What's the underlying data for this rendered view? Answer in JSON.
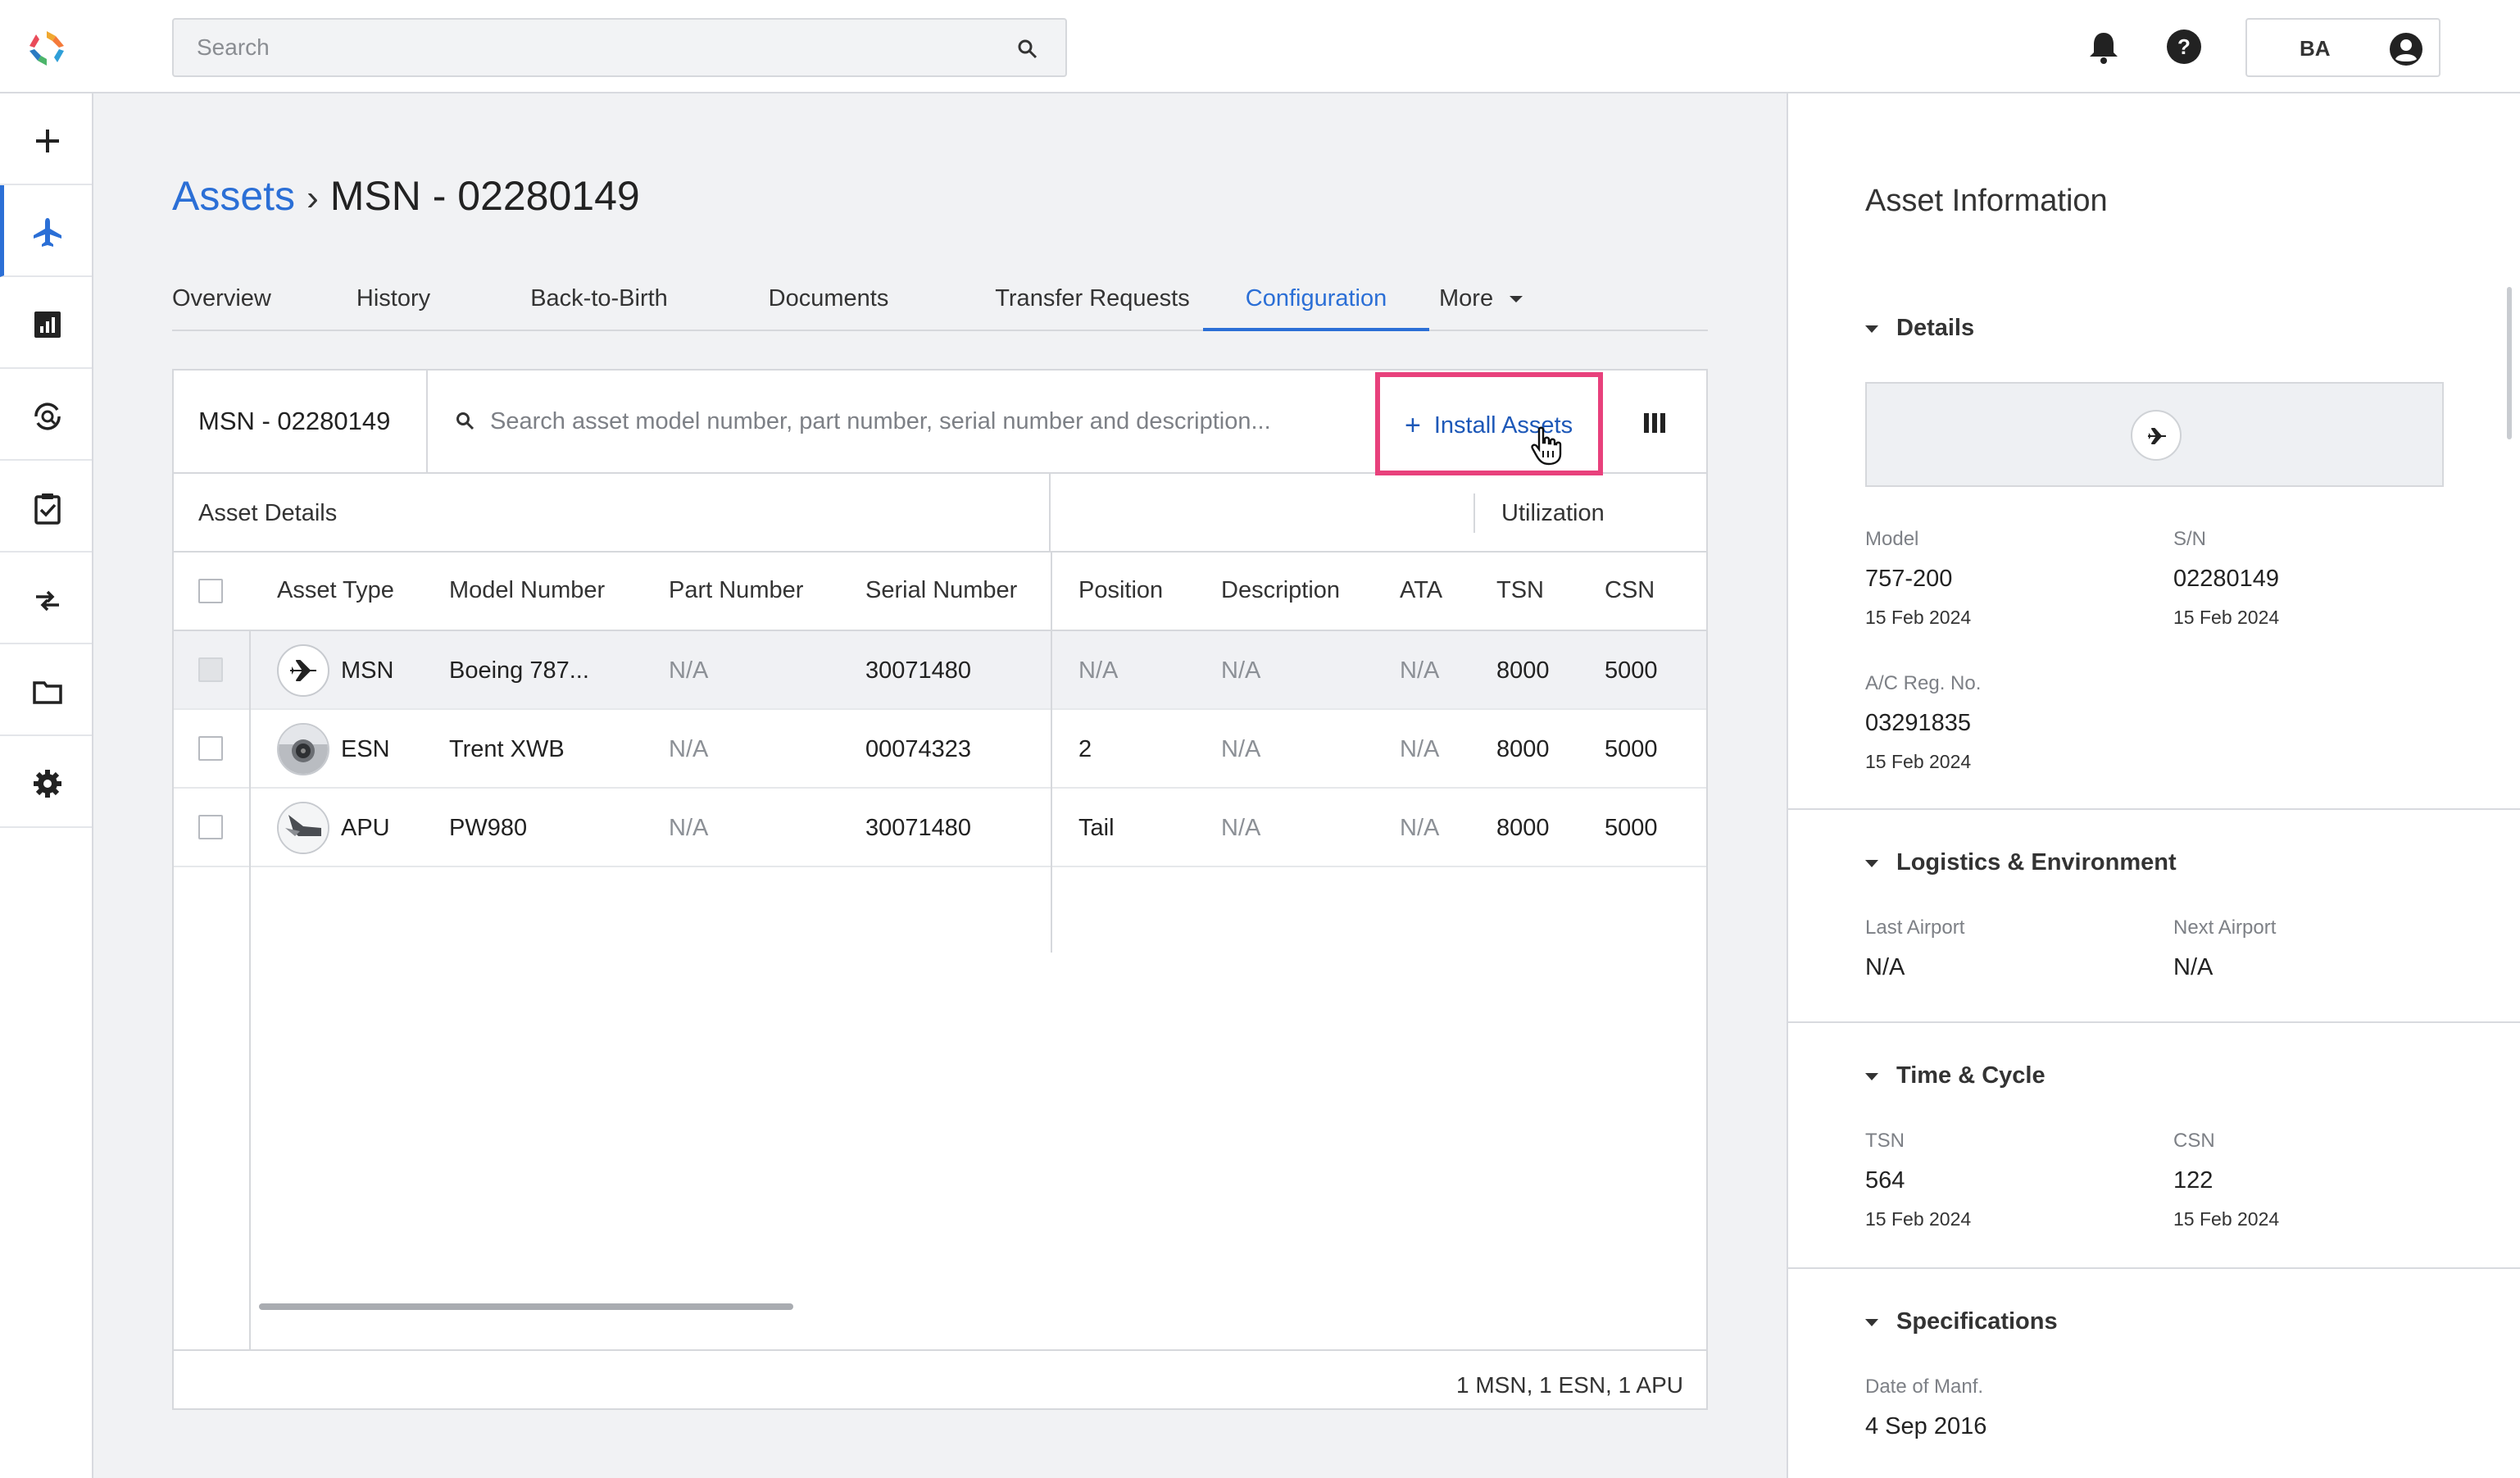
{
  "topbar": {
    "search_placeholder": "Search",
    "user_initials": "BA"
  },
  "breadcrumb": {
    "root": "Assets",
    "separator": "›",
    "current": "MSN - 02280149"
  },
  "tabs": [
    {
      "label": "Overview"
    },
    {
      "label": "History"
    },
    {
      "label": "Back-to-Birth"
    },
    {
      "label": "Documents"
    },
    {
      "label": "Transfer Requests"
    },
    {
      "label": "Configuration",
      "active": true
    },
    {
      "label": "More"
    }
  ],
  "toolbar": {
    "msn_label": "MSN - 02280149",
    "search_placeholder": "Search asset model number, part number, serial number and description...",
    "install_label": "Install Assets"
  },
  "table": {
    "group_left": "Asset Details",
    "group_right": "Utilization",
    "headers": {
      "asset_type": "Asset Type",
      "model_number": "Model Number",
      "part_number": "Part Number",
      "serial_number": "Serial Number",
      "position": "Position",
      "description": "Description",
      "ata": "ATA",
      "tsn": "TSN",
      "csn": "CSN"
    },
    "rows": [
      {
        "type": "MSN",
        "icon": "airplane-icon",
        "model": "Boeing 787...",
        "part": "N/A",
        "serial": "30071480",
        "position": "N/A",
        "description": "N/A",
        "ata": "N/A",
        "tsn": "8000",
        "csn": "5000"
      },
      {
        "type": "ESN",
        "icon": "engine-icon",
        "model": "Trent XWB",
        "part": "N/A",
        "serial": "00074323",
        "position": "2",
        "description": "N/A",
        "ata": "N/A",
        "tsn": "8000",
        "csn": "5000"
      },
      {
        "type": "APU",
        "icon": "tail-icon",
        "model": "PW980",
        "part": "N/A",
        "serial": "30071480",
        "position": "Tail",
        "description": "N/A",
        "ata": "N/A",
        "tsn": "8000",
        "csn": "5000"
      }
    ],
    "summary": "1 MSN, 1 ESN, 1 APU"
  },
  "panel": {
    "title": "Asset Information",
    "details": {
      "heading": "Details",
      "model_label": "Model",
      "model_value": "757-200",
      "model_date": "15 Feb 2024",
      "sn_label": "S/N",
      "sn_value": "02280149",
      "sn_date": "15 Feb 2024",
      "reg_label": "A/C Reg. No.",
      "reg_value": "03291835",
      "reg_date": "15 Feb 2024"
    },
    "logistics": {
      "heading": "Logistics & Environment",
      "last_label": "Last Airport",
      "last_value": "N/A",
      "next_label": "Next Airport",
      "next_value": "N/A"
    },
    "time_cycle": {
      "heading": "Time & Cycle",
      "tsn_label": "TSN",
      "tsn_value": "564",
      "tsn_date": "15 Feb 2024",
      "csn_label": "CSN",
      "csn_value": "122",
      "csn_date": "15 Feb 2024"
    },
    "specifications": {
      "heading": "Specifications",
      "manf_label": "Date of Manf.",
      "manf_value": "4 Sep 2016"
    }
  },
  "colors": {
    "accent": "#2b6fd6",
    "highlight_border": "#e8417c",
    "background": "#f1f2f4"
  }
}
